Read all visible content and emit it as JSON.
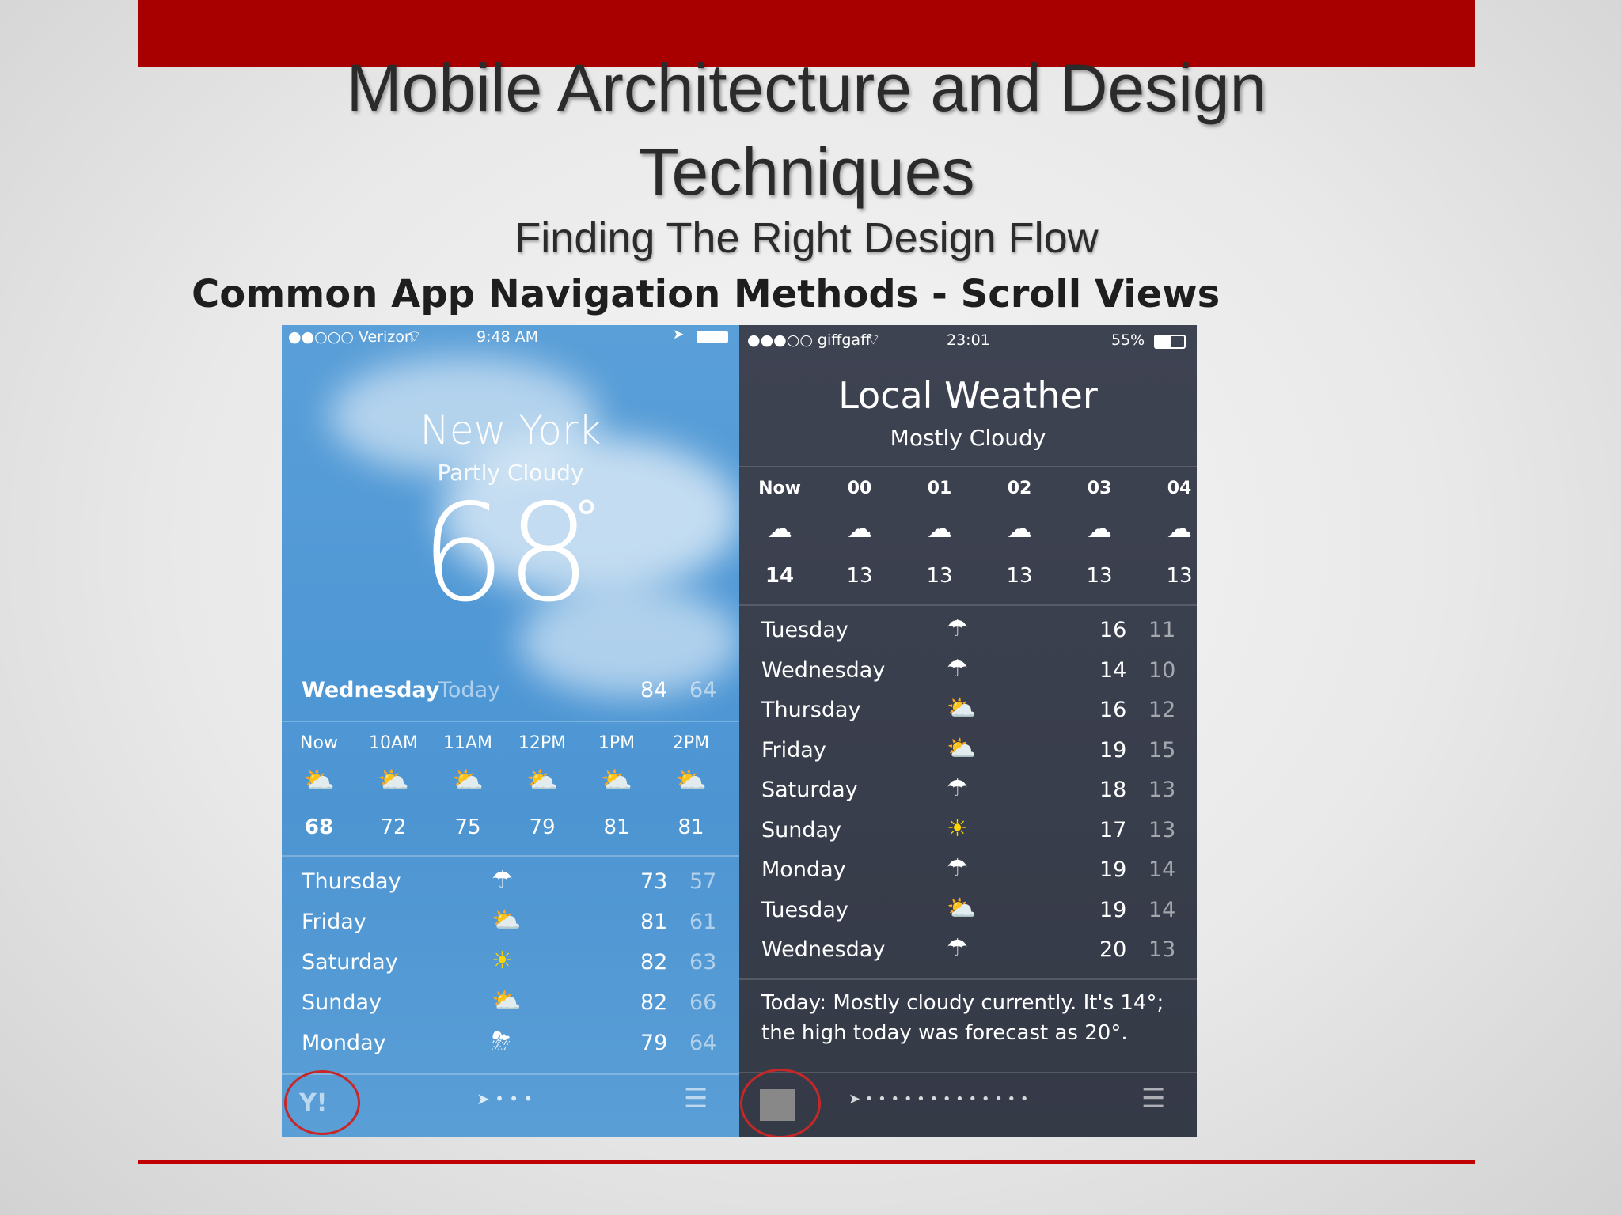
{
  "slide": {
    "title_line1": "Mobile Architecture and Design",
    "title_line2": "Techniques",
    "subtitle": "Finding The Right Design Flow",
    "heading": "Common App Navigation Methods - Scroll Views"
  },
  "colors": {
    "accent_red": "#a80000",
    "left_bg": "#4f98d6",
    "right_bg": "#3a3f4c"
  },
  "left_phone": {
    "status": {
      "carrier": "●●○○○ Verizon",
      "time": "9:48 AM"
    },
    "city": "New York",
    "condition": "Partly Cloudy",
    "temp": "68",
    "today": {
      "day": "Wednesday",
      "label": "Today",
      "high": "84",
      "low": "64"
    },
    "hours": [
      {
        "label": "Now",
        "temp": "68",
        "icon": "partly-sunny-icon"
      },
      {
        "label": "10AM",
        "temp": "72",
        "icon": "partly-sunny-icon"
      },
      {
        "label": "11AM",
        "temp": "75",
        "icon": "partly-sunny-icon"
      },
      {
        "label": "12PM",
        "temp": "79",
        "icon": "partly-sunny-icon"
      },
      {
        "label": "1PM",
        "temp": "81",
        "icon": "partly-sunny-icon"
      },
      {
        "label": "2PM",
        "temp": "81",
        "icon": "partly-sunny-icon"
      }
    ],
    "days": [
      {
        "day": "Thursday",
        "high": "73",
        "low": "57",
        "icon": "cloud-rain-icon"
      },
      {
        "day": "Friday",
        "high": "81",
        "low": "61",
        "icon": "partly-sunny-icon"
      },
      {
        "day": "Saturday",
        "high": "82",
        "low": "63",
        "icon": "sun-icon"
      },
      {
        "day": "Sunday",
        "high": "82",
        "low": "66",
        "icon": "partly-sunny-icon"
      },
      {
        "day": "Monday",
        "high": "79",
        "low": "64",
        "icon": "thunderstorm-icon"
      }
    ]
  },
  "right_phone": {
    "status": {
      "carrier": "●●●○○ giffgaff",
      "time": "23:01",
      "battery": "55%"
    },
    "city": "Local Weather",
    "condition": "Mostly Cloudy",
    "hours": [
      {
        "label": "Now",
        "temp": "14",
        "icon": "cloud-icon"
      },
      {
        "label": "00",
        "temp": "13",
        "icon": "cloud-moon-icon"
      },
      {
        "label": "01",
        "temp": "13",
        "icon": "cloud-fog-icon"
      },
      {
        "label": "02",
        "temp": "13",
        "icon": "cloud-fog-icon"
      },
      {
        "label": "03",
        "temp": "13",
        "icon": "cloud-fog-icon"
      },
      {
        "label": "04",
        "temp": "13",
        "icon": "cloud-fog-icon"
      }
    ],
    "days": [
      {
        "day": "Tuesday",
        "high": "16",
        "low": "11",
        "icon": "cloud-rain-icon"
      },
      {
        "day": "Wednesday",
        "high": "14",
        "low": "10",
        "icon": "cloud-rain-icon"
      },
      {
        "day": "Thursday",
        "high": "16",
        "low": "12",
        "icon": "partly-sunny-icon"
      },
      {
        "day": "Friday",
        "high": "19",
        "low": "15",
        "icon": "partly-sunny-icon"
      },
      {
        "day": "Saturday",
        "high": "18",
        "low": "13",
        "icon": "cloud-rain-icon"
      },
      {
        "day": "Sunday",
        "high": "17",
        "low": "13",
        "icon": "sun-icon"
      },
      {
        "day": "Monday",
        "high": "19",
        "low": "14",
        "icon": "cloud-rain-icon"
      },
      {
        "day": "Tuesday",
        "high": "19",
        "low": "14",
        "icon": "partly-sunny-icon"
      },
      {
        "day": "Wednesday",
        "high": "20",
        "low": "13",
        "icon": "cloud-rain-icon"
      }
    ],
    "summary_line1": "Today: Mostly cloudy currently. It's 14°;",
    "summary_line2": "the high today was forecast as 20°."
  }
}
